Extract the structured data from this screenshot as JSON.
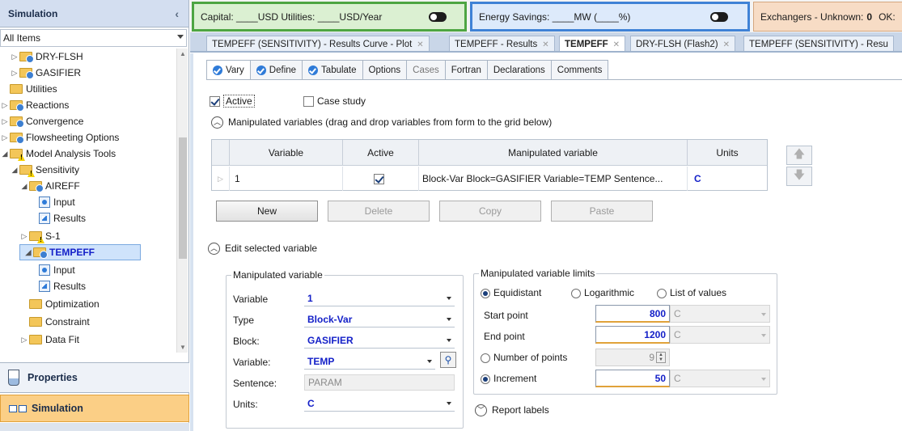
{
  "nav": {
    "header": "Simulation",
    "filter": "All Items",
    "tree": [
      {
        "label": "DRY-FLSH"
      },
      {
        "label": "GASIFIER"
      },
      {
        "label": "Utilities"
      },
      {
        "label": "Reactions"
      },
      {
        "label": "Convergence"
      },
      {
        "label": "Flowsheeting Options"
      },
      {
        "label": "Model Analysis Tools"
      },
      {
        "label": "Sensitivity"
      },
      {
        "label": "AIREFF"
      },
      {
        "label": "Input"
      },
      {
        "label": "Results"
      },
      {
        "label": "S-1"
      },
      {
        "label": "TEMPEFF"
      },
      {
        "label": "Input"
      },
      {
        "label": "Results"
      },
      {
        "label": "Optimization"
      },
      {
        "label": "Constraint"
      },
      {
        "label": "Data Fit"
      }
    ],
    "properties_label": "Properties",
    "simulation_label": "Simulation"
  },
  "topbar": {
    "cost_text": "Capital: ____USD  Utilities: ____USD/Year",
    "energy_text": "Energy Savings: ____MW  (____%)",
    "exchangers_prefix": "Exchangers - Unknown:",
    "exchangers_count": "0",
    "exchangers_suffix": "OK:"
  },
  "doc_tabs": [
    {
      "label": "TEMPEFF (SENSITIVITY) - Results Curve - Plot"
    },
    {
      "label": "TEMPEFF - Results"
    },
    {
      "label": "TEMPEFF"
    },
    {
      "label": "DRY-FLSH (Flash2)"
    },
    {
      "label": "TEMPEFF (SENSITIVITY) - Resu"
    }
  ],
  "form_tabs": [
    {
      "label": "Vary"
    },
    {
      "label": "Define"
    },
    {
      "label": "Tabulate"
    },
    {
      "label": "Options"
    },
    {
      "label": "Cases"
    },
    {
      "label": "Fortran"
    },
    {
      "label": "Declarations"
    },
    {
      "label": "Comments"
    }
  ],
  "vary": {
    "active_label": "Active",
    "case_study_label": "Case study",
    "manip_section_label": "Manipulated variables (drag and drop variables from form to the grid below)",
    "grid": {
      "headers": [
        "Variable",
        "Active",
        "Manipulated variable",
        "Units"
      ],
      "rows": [
        {
          "variable": "1",
          "description": "Block-Var Block=GASIFIER Variable=TEMP Sentence...",
          "units": "C"
        }
      ]
    },
    "buttons": {
      "new": "New",
      "delete": "Delete",
      "copy": "Copy",
      "paste": "Paste"
    },
    "edit_section_label": "Edit selected variable",
    "manip_group_title": "Manipulated variable",
    "fields": {
      "variable_label": "Variable",
      "variable_value": "1",
      "type_label": "Type",
      "type_value": "Block-Var",
      "block_label": "Block:",
      "block_value": "GASIFIER",
      "var_label": "Variable:",
      "var_value": "TEMP",
      "sentence_label": "Sentence:",
      "sentence_value": "PARAM",
      "units_label": "Units:",
      "units_value": "C"
    },
    "limits_group_title": "Manipulated variable limits",
    "limits": {
      "equidistant_label": "Equidistant",
      "log_label": "Logarithmic",
      "list_label": "List of values",
      "start_label": "Start point",
      "start_value": "800",
      "start_unit": "C",
      "end_label": "End point",
      "end_value": "1200",
      "end_unit": "C",
      "npoints_label": "Number of points",
      "npoints_value": "9",
      "increment_label": "Increment",
      "increment_value": "50",
      "increment_unit": "C"
    },
    "report_labels": "Report labels"
  }
}
